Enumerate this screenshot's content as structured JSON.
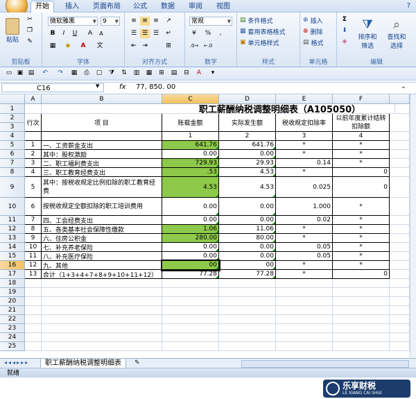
{
  "tabs": [
    "开始",
    "插入",
    "页面布局",
    "公式",
    "数据",
    "审阅",
    "视图"
  ],
  "ribbon": {
    "clipboard": {
      "label": "剪贴板",
      "paste": "粘贴"
    },
    "font": {
      "label": "字体",
      "name": "微软雅黑",
      "size": "9"
    },
    "alignment": {
      "label": "对齐方式"
    },
    "number": {
      "label": "数字",
      "format": "常规",
      "percent": "%",
      "comma": ","
    },
    "styles": {
      "label": "样式",
      "cond": "条件格式",
      "table": "套用表格格式",
      "cell": "单元格样式"
    },
    "cells": {
      "label": "单元格",
      "insert": "插入",
      "delete": "删除",
      "format": "格式"
    },
    "editing": {
      "label": "编辑",
      "sort": "排序和",
      "sort2": "筛选",
      "find": "查找和",
      "find2": "选择"
    }
  },
  "formula_bar": {
    "cell_ref": "C16",
    "fx": "fx",
    "value": "77, 850. 00"
  },
  "columns": [
    "A",
    "B",
    "C",
    "D",
    "E",
    "F"
  ],
  "sheet": {
    "title": "职工薪酬纳税调整明细表（A105050）",
    "header": {
      "seq": "行次",
      "item": "项    目",
      "c": "账载金额",
      "d": "实际发生额",
      "e": "税收规定扣除率",
      "f": "以前年度累计结转扣除额"
    },
    "colnums": {
      "c": "1",
      "d": "2",
      "e": "3",
      "f": "4"
    },
    "rows": [
      {
        "r": "5",
        "seq": "1",
        "item": "一、工资薪金支出",
        "c": "641.76",
        "d": "641.76",
        "e": "*",
        "f": "*"
      },
      {
        "r": "6",
        "seq": "2",
        "item": "    其中：股权激励",
        "c": "0.00",
        "d": "0.00",
        "e": "*",
        "f": "*"
      },
      {
        "r": "7",
        "seq": "3",
        "item": "二、职工福利费支出",
        "c": "729.93",
        "d": "29.93",
        "e": "0.14",
        "f": "*"
      },
      {
        "r": "8",
        "seq": "4",
        "item": "三、职工教育经费支出",
        "c": ".53",
        "d": "4.53",
        "e": "*",
        "f": "0"
      },
      {
        "r": "9",
        "seq": "5",
        "item": "    其中：按税收规定比例扣除的职工教育经费",
        "c": "4.53",
        "d": "4.53",
        "e": "0.025",
        "f": "0"
      },
      {
        "r": "10",
        "seq": "6",
        "item": "        按税收规定全额扣除的职工培训费用",
        "c": "0.00",
        "d": "0.00",
        "e": "1.000",
        "f": "*"
      },
      {
        "r": "11",
        "seq": "7",
        "item": "四、工会经费支出",
        "c": "0.00",
        "d": "0.00",
        "e": "0.02",
        "f": "*"
      },
      {
        "r": "12",
        "seq": "8",
        "item": "五、各类基本社会保障性缴款",
        "c": "1.06",
        "d": "11.06",
        "e": "*",
        "f": "*"
      },
      {
        "r": "13",
        "seq": "9",
        "item": "六、住房公积金",
        "c": "280.00",
        "d": "80.00",
        "e": "*",
        "f": "*"
      },
      {
        "r": "14",
        "seq": "10",
        "item": "七、补充养老保险",
        "c": "0.00",
        "d": "0.00",
        "e": "0.05",
        "f": "*"
      },
      {
        "r": "15",
        "seq": "11",
        "item": "八、补充医疗保险",
        "c": "0.00",
        "d": "0.00",
        "e": "0.05",
        "f": "*"
      },
      {
        "r": "16",
        "seq": "12",
        "item": "九、其他",
        "c": "00",
        "d": "00",
        "e": "*",
        "f": "*"
      },
      {
        "r": "17",
        "seq": "13",
        "item": "合计（1+3+4+7+8+9+10+11+12）",
        "c": "77.28",
        "d": "77.28",
        "e": "*",
        "f": "0"
      }
    ],
    "empty_rows": [
      "18",
      "19",
      "20",
      "21",
      "22",
      "23",
      "24",
      "25"
    ]
  },
  "sheet_tab": "职工薪酬纳税调整明细表",
  "status": "就绪",
  "watermark": {
    "cn": "乐享财税",
    "en": "LE XIANG CAI SHUI"
  }
}
